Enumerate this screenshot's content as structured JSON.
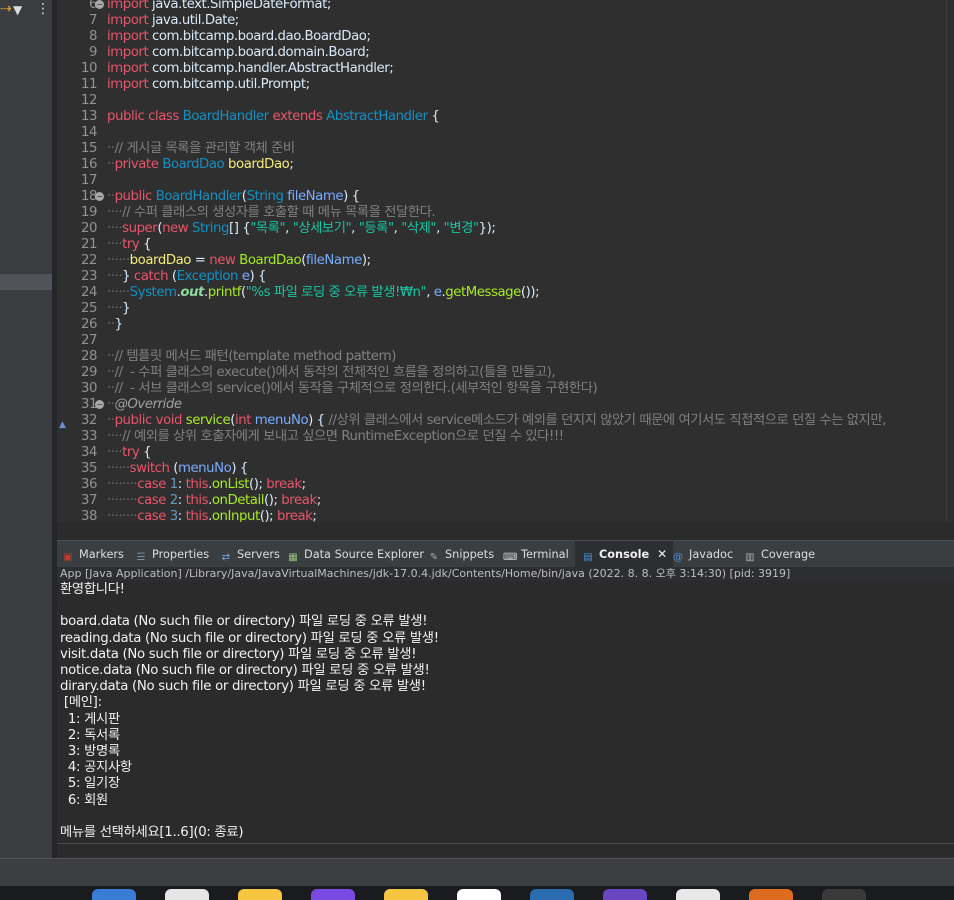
{
  "editor": {
    "lines": [
      {
        "n": "6",
        "fold": true,
        "parts": [
          [
            "k",
            "import"
          ],
          [
            "id",
            " java.text.SimpleDateFormat;"
          ]
        ]
      },
      {
        "n": "7",
        "parts": [
          [
            "k",
            "import"
          ],
          [
            "id",
            " java.util.Date;"
          ]
        ]
      },
      {
        "n": "8",
        "parts": [
          [
            "k",
            "import"
          ],
          [
            "id",
            " com.bitcamp.board.dao.BoardDao;"
          ]
        ]
      },
      {
        "n": "9",
        "parts": [
          [
            "k",
            "import"
          ],
          [
            "id",
            " com.bitcamp.board.domain.Board;"
          ]
        ]
      },
      {
        "n": "10",
        "parts": [
          [
            "k",
            "import"
          ],
          [
            "id",
            " com.bitcamp.handler.AbstractHandler;"
          ]
        ]
      },
      {
        "n": "11",
        "parts": [
          [
            "k",
            "import"
          ],
          [
            "id",
            " com.bitcamp.util.Prompt;"
          ]
        ]
      },
      {
        "n": "12",
        "parts": []
      },
      {
        "n": "13",
        "parts": [
          [
            "k",
            "public"
          ],
          [
            "id",
            " "
          ],
          [
            "k",
            "class"
          ],
          [
            "id",
            " "
          ],
          [
            "t",
            "BoardHandler"
          ],
          [
            "id",
            " "
          ],
          [
            "k",
            "extends"
          ],
          [
            "id",
            " "
          ],
          [
            "t",
            "AbstractHandler"
          ],
          [
            "id",
            " {"
          ]
        ]
      },
      {
        "n": "14",
        "parts": []
      },
      {
        "n": "15",
        "parts": [
          [
            "ws",
            "··"
          ],
          [
            "c",
            "// 게시글 목록을 관리할 객체 준비"
          ]
        ]
      },
      {
        "n": "16",
        "parts": [
          [
            "ws",
            "··"
          ],
          [
            "k",
            "private"
          ],
          [
            "id",
            " "
          ],
          [
            "t",
            "BoardDao"
          ],
          [
            "id",
            " "
          ],
          [
            "f",
            "boardDao"
          ],
          [
            "id",
            ";"
          ]
        ]
      },
      {
        "n": "17",
        "parts": []
      },
      {
        "n": "18",
        "fold": true,
        "parts": [
          [
            "ws",
            "··"
          ],
          [
            "k",
            "public"
          ],
          [
            "id",
            " "
          ],
          [
            "t",
            "BoardHandler"
          ],
          [
            "id",
            "("
          ],
          [
            "t",
            "String"
          ],
          [
            "id",
            " "
          ],
          [
            "v",
            "fileName"
          ],
          [
            "id",
            ") {"
          ]
        ]
      },
      {
        "n": "19",
        "parts": [
          [
            "ws",
            "····"
          ],
          [
            "c",
            "// 수퍼 클래스의 생성자를 호출할 때 메뉴 목록을 전달한다."
          ]
        ]
      },
      {
        "n": "20",
        "parts": [
          [
            "ws",
            "····"
          ],
          [
            "k",
            "super"
          ],
          [
            "id",
            "("
          ],
          [
            "k",
            "new"
          ],
          [
            "id",
            " "
          ],
          [
            "t",
            "String"
          ],
          [
            "id",
            "[] {"
          ],
          [
            "s",
            "\"목록\""
          ],
          [
            "id",
            ", "
          ],
          [
            "s",
            "\"상세보기\""
          ],
          [
            "id",
            ", "
          ],
          [
            "s",
            "\"등록\""
          ],
          [
            "id",
            ", "
          ],
          [
            "s",
            "\"삭제\""
          ],
          [
            "id",
            ", "
          ],
          [
            "s",
            "\"변경\""
          ],
          [
            "id",
            "});"
          ]
        ]
      },
      {
        "n": "21",
        "parts": [
          [
            "ws",
            "····"
          ],
          [
            "k",
            "try"
          ],
          [
            "id",
            " {"
          ]
        ]
      },
      {
        "n": "22",
        "parts": [
          [
            "ws",
            "······"
          ],
          [
            "f",
            "boardDao"
          ],
          [
            "id",
            " = "
          ],
          [
            "k",
            "new"
          ],
          [
            "id",
            " "
          ],
          [
            "fn",
            "BoardDao"
          ],
          [
            "id",
            "("
          ],
          [
            "v",
            "fileName"
          ],
          [
            "id",
            ");"
          ]
        ]
      },
      {
        "n": "23",
        "parts": [
          [
            "ws",
            "····"
          ],
          [
            "id",
            "} "
          ],
          [
            "k",
            "catch"
          ],
          [
            "id",
            " ("
          ],
          [
            "t",
            "Exception"
          ],
          [
            "id",
            " "
          ],
          [
            "v",
            "e"
          ],
          [
            "id",
            ") {"
          ]
        ]
      },
      {
        "n": "24",
        "parts": [
          [
            "ws",
            "······"
          ],
          [
            "t",
            "System"
          ],
          [
            "id",
            "."
          ],
          [
            "st",
            "out"
          ],
          [
            "id",
            "."
          ],
          [
            "fn",
            "printf"
          ],
          [
            "id",
            "("
          ],
          [
            "s",
            "\"%s 파일 로딩 중 오류 발생!₩n\""
          ],
          [
            "id",
            ", "
          ],
          [
            "v",
            "e"
          ],
          [
            "id",
            "."
          ],
          [
            "fn",
            "getMessage"
          ],
          [
            "id",
            "());"
          ]
        ]
      },
      {
        "n": "25",
        "parts": [
          [
            "ws",
            "····"
          ],
          [
            "id",
            "}"
          ]
        ]
      },
      {
        "n": "26",
        "parts": [
          [
            "ws",
            "··"
          ],
          [
            "id",
            "}"
          ]
        ]
      },
      {
        "n": "27",
        "parts": []
      },
      {
        "n": "28",
        "parts": [
          [
            "ws",
            "··"
          ],
          [
            "c",
            "// 템플릿 메서드 패턴(template method pattern)"
          ]
        ]
      },
      {
        "n": "29",
        "parts": [
          [
            "ws",
            "··"
          ],
          [
            "c",
            "//  - 수퍼 클래스의 execute()에서 동작의 전체적인 흐름을 정의하고(틀을 만들고),"
          ]
        ]
      },
      {
        "n": "30",
        "parts": [
          [
            "ws",
            "··"
          ],
          [
            "c",
            "//  - 서브 클래스의 service()에서 동작을 구체적으로 정의한다.(세부적인 항목을 구현한다)"
          ]
        ]
      },
      {
        "n": "31",
        "fold": true,
        "parts": [
          [
            "ws",
            "··"
          ],
          [
            "an",
            "@Override"
          ]
        ]
      },
      {
        "n": "32",
        "warn": true,
        "parts": [
          [
            "ws",
            "··"
          ],
          [
            "k",
            "public"
          ],
          [
            "id",
            " "
          ],
          [
            "k",
            "void"
          ],
          [
            "id",
            " "
          ],
          [
            "fn",
            "service"
          ],
          [
            "id",
            "("
          ],
          [
            "k",
            "int"
          ],
          [
            "id",
            " "
          ],
          [
            "v",
            "menuNo"
          ],
          [
            "id",
            ") { "
          ],
          [
            "c",
            "//상위 클래스에서 service메소드가 예외를 던지지 않았기 때문에 여기서도 직접적으로 던질 수는 없지만,"
          ]
        ]
      },
      {
        "n": "33",
        "parts": [
          [
            "ws",
            "····"
          ],
          [
            "c",
            "// 예외를 상위 호출자에게 보내고 싶으면 RuntimeException으로 던질 수 있다!!!"
          ]
        ]
      },
      {
        "n": "34",
        "parts": [
          [
            "ws",
            "····"
          ],
          [
            "k",
            "try"
          ],
          [
            "id",
            " {"
          ]
        ]
      },
      {
        "n": "35",
        "parts": [
          [
            "ws",
            "······"
          ],
          [
            "k",
            "switch"
          ],
          [
            "id",
            " ("
          ],
          [
            "v",
            "menuNo"
          ],
          [
            "id",
            ") {"
          ]
        ]
      },
      {
        "n": "36",
        "parts": [
          [
            "ws",
            "········"
          ],
          [
            "k",
            "case"
          ],
          [
            "id",
            " "
          ],
          [
            "n",
            "1"
          ],
          [
            "id",
            ": "
          ],
          [
            "k",
            "this"
          ],
          [
            "id",
            "."
          ],
          [
            "fn",
            "onList"
          ],
          [
            "id",
            "(); "
          ],
          [
            "k",
            "break"
          ],
          [
            "id",
            ";"
          ]
        ]
      },
      {
        "n": "37",
        "parts": [
          [
            "ws",
            "········"
          ],
          [
            "k",
            "case"
          ],
          [
            "id",
            " "
          ],
          [
            "n",
            "2"
          ],
          [
            "id",
            ": "
          ],
          [
            "k",
            "this"
          ],
          [
            "id",
            "."
          ],
          [
            "fn",
            "onDetail"
          ],
          [
            "id",
            "(); "
          ],
          [
            "k",
            "break"
          ],
          [
            "id",
            ";"
          ]
        ]
      },
      {
        "n": "38",
        "parts": [
          [
            "ws",
            "········"
          ],
          [
            "k",
            "case"
          ],
          [
            "id",
            " "
          ],
          [
            "n",
            "3"
          ],
          [
            "id",
            ": "
          ],
          [
            "k",
            "this"
          ],
          [
            "id",
            "."
          ],
          [
            "fn",
            "onInput"
          ],
          [
            "id",
            "(); "
          ],
          [
            "k",
            "break"
          ],
          [
            "id",
            ";"
          ]
        ]
      }
    ]
  },
  "panel": {
    "tabs": [
      {
        "label": "Markers",
        "icon": "markers-icon",
        "color": "#c0392b",
        "glyph": "▣"
      },
      {
        "label": "Properties",
        "icon": "properties-icon",
        "color": "#7a8ca3",
        "glyph": "☰"
      },
      {
        "label": "Servers",
        "icon": "servers-icon",
        "color": "#6fa8dc",
        "glyph": "⇄"
      },
      {
        "label": "Data Source Explorer",
        "icon": "data-source-icon",
        "color": "#93c47d",
        "glyph": "▦"
      },
      {
        "label": "Snippets",
        "icon": "snippets-icon",
        "color": "#aaaaaa",
        "glyph": "✎"
      },
      {
        "label": "Terminal",
        "icon": "terminal-icon",
        "color": "#cccccc",
        "glyph": "⌨"
      },
      {
        "label": "Console",
        "icon": "console-icon",
        "color": "#4a90d9",
        "glyph": "▤",
        "active": true
      },
      {
        "label": "Javadoc",
        "icon": "javadoc-icon",
        "color": "#4a90d9",
        "glyph": "@"
      },
      {
        "label": "Coverage",
        "icon": "coverage-icon",
        "color": "#aaaaaa",
        "glyph": "▥"
      }
    ],
    "close_glyph": "✕",
    "console_header": "App [Java Application] /Library/Java/JavaVirtualMachines/jdk-17.0.4.jdk/Contents/Home/bin/java  (2022. 8. 8. 오후 3:14:30) [pid: 3919]",
    "console_lines": [
      "환영합니다!",
      "",
      "board.data (No such file or directory) 파일 로딩 중 오류 발생!",
      "reading.data (No such file or directory) 파일 로딩 중 오류 발생!",
      "visit.data (No such file or directory) 파일 로딩 중 오류 발생!",
      "notice.data (No such file or directory) 파일 로딩 중 오류 발생!",
      "dirary.data (No such file or directory) 파일 로딩 중 오류 발생!",
      " [메인]:",
      "  1: 게시판",
      "  2: 독서록",
      "  3: 방명록",
      "  4: 공지사항",
      "  5: 일기장",
      "  6: 회원",
      "",
      "메뉴를 선택하세요[1..6](0: 종료)"
    ]
  },
  "toolbar": {
    "icons": [
      {
        "name": "link-editor-icon",
        "glyph": "⇢"
      },
      {
        "name": "filter-icon",
        "glyph": "▼"
      },
      {
        "name": "view-menu-icon",
        "glyph": "⋮"
      }
    ]
  },
  "dock": {
    "colors": [
      "#3a7bd5",
      "#e6e6e6",
      "#f5c542",
      "#7b4ae2",
      "#f5c542",
      "#ffffff",
      "#2b6cb0",
      "#6b46c1",
      "#e8e8e8",
      "#dd6b20",
      "#3a3a3a"
    ]
  }
}
